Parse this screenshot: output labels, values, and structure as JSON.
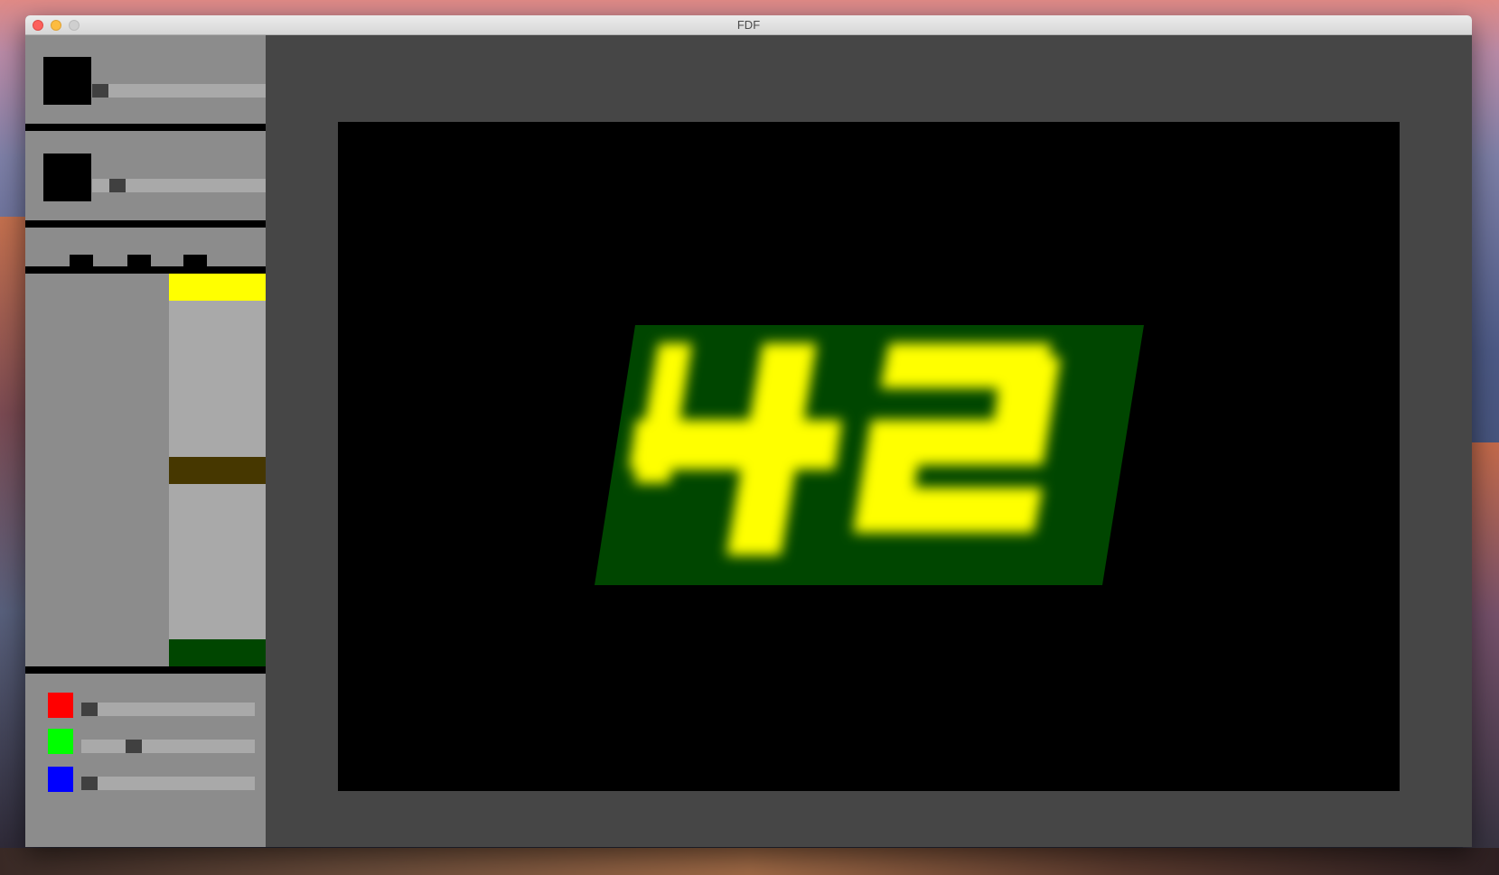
{
  "window": {
    "title": "FDF"
  },
  "controls": {
    "slider_1": {
      "value": 0.0
    },
    "slider_2": {
      "value": 0.11
    },
    "view_buttons": [
      "view-button",
      "view-button",
      "view-button"
    ]
  },
  "palette": {
    "stops": [
      {
        "name": "top-color-stop",
        "color": "#ffff00",
        "position": 0.0
      },
      {
        "name": "mid-color-stop",
        "color": "#463700",
        "position": 0.5
      },
      {
        "name": "bottom-color-stop",
        "color": "#004600",
        "position": 1.0
      }
    ]
  },
  "rgb": [
    {
      "name": "red",
      "color": "#ff0000",
      "value": 0.0
    },
    {
      "name": "green",
      "color": "#00ff00",
      "value": 0.28
    },
    {
      "name": "blue",
      "color": "#0000ff",
      "value": 0.0
    }
  ],
  "render": {
    "background": "#000000",
    "plane_color": "#004600",
    "peak_color": "#ffff00",
    "map_name": "42"
  }
}
